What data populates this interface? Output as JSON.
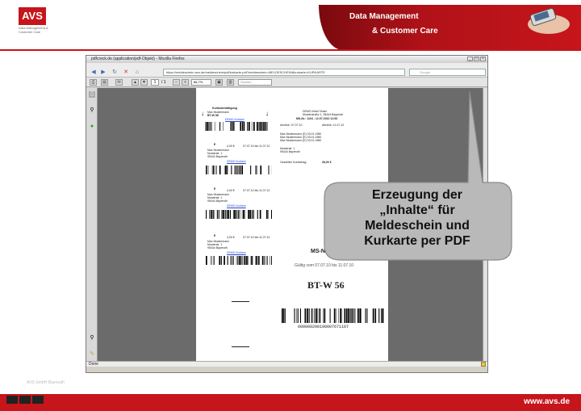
{
  "header": {
    "logo_text": "AVS",
    "logo_subtext": "Data Management & Customer Care",
    "title_line1": "Data Management",
    "title_line2": "& Customer Care"
  },
  "browser": {
    "window_title": "pdfcreck.de (application/pdf-Objekt) - Mozilla Firefox",
    "url": "https://meldeschein.avs.de/meldeschein/pdf/kurkarte.pdf?meldeschein=MELDESCHEIN&kurkarte=KURKARTE",
    "search_placeholder": "Google",
    "page_current": "1",
    "page_total": "/ 1",
    "zoom": "86,7%",
    "find_placeholder": "Suchen",
    "status": "Done"
  },
  "pdf": {
    "top_stub_title": "Kurtaxbestätigung",
    "top_stub_name": "Max Mustermann",
    "top_stub_code": "BT-W 56",
    "top_stub_link": "DEMO-Kurtaxe",
    "header_right_line1": "DEMO-Hotel Tester",
    "header_right_line2": "Musterstraße 1, 95444 Bayreuth",
    "header_ms_nr": "MS-Nr.: 1104 - 12.07.2010 11:53",
    "anreise_label": "Anreise: 07.07.10",
    "abreise_label": "Abreise: 11.07.10",
    "guests": [
      "Max Mustermann (E) 03.01.1980",
      "Max Mustermann (E) 03.01.1980",
      "Max Mustermann (E) 03.01.1980"
    ],
    "address_line1": "Musterstr. 1",
    "address_line2": "95444 Bayreuth",
    "paid_label": "Gezahlter Kurbeitrag:",
    "paid_value": "28,00 €",
    "stub_name": "Max Mustermann",
    "stub_street": "Musterstr. 1",
    "stub_city": "95444 Bayreuth",
    "stub_link": "DEMO-Kurtaxe",
    "stub_price": "4,00 €",
    "stub_dates": "07.07.10 bis 11.07.10",
    "card_title": "MS-Nr.",
    "card_valid": "Gültig vom 07.07.10 bis 11.07.10",
    "card_code": "BT-W 56",
    "card_barcode_number": "000000290190007671107"
  },
  "callout": {
    "line1": "Erzeugung der",
    "line2": "„Inhalte“ für",
    "line3": "Meldeschein und",
    "line4": "Kurkarte per PDF"
  },
  "footer": {
    "url": "www.avs.de",
    "note": "AVS GmbH Bayreuth"
  },
  "colors": {
    "brand_red": "#c6151b",
    "viewer_gray": "#6b6b6b",
    "callout_fill": "#b9b9b9"
  }
}
